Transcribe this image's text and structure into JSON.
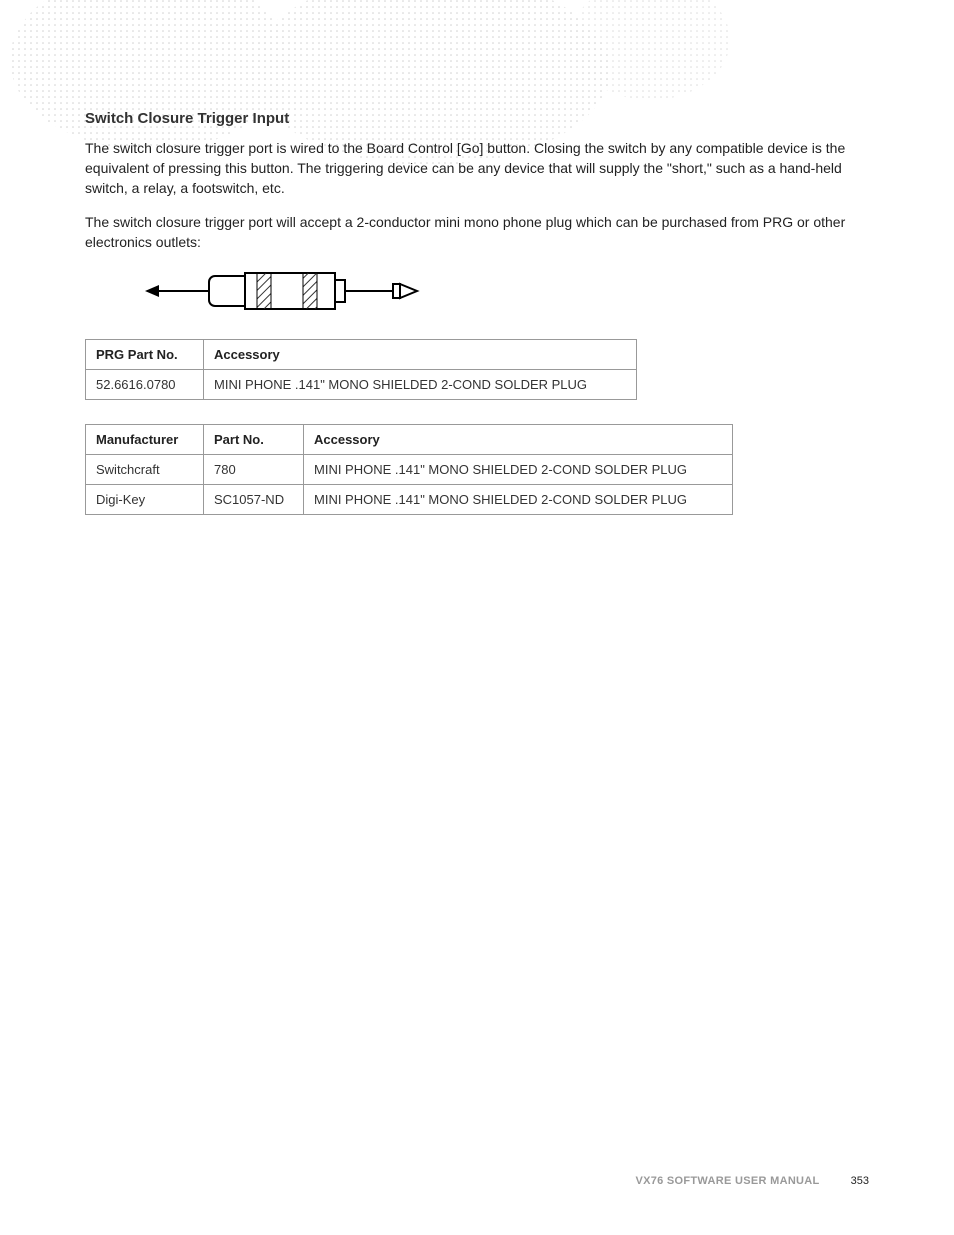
{
  "heading": "Switch Closure Trigger Input",
  "para1": "The switch closure trigger port is wired to the Board Control [Go] button. Closing the switch by any compatible device is the equivalent of pressing this button. The triggering device can be any device that will supply the \"short,\" such as a hand-held switch, a relay, a footswitch, etc.",
  "para2": "The switch closure trigger port will accept a 2-conductor mini mono phone plug which can be purchased from PRG or other electronics outlets:",
  "table1": {
    "headers": [
      "PRG Part No.",
      "Accessory"
    ],
    "rows": [
      [
        "52.6616.0780",
        "MINI PHONE .141\" MONO SHIELDED 2-COND SOLDER PLUG"
      ]
    ]
  },
  "table2": {
    "headers": [
      "Manufacturer",
      "Part No.",
      "Accessory"
    ],
    "rows": [
      [
        "Switchcraft",
        "780",
        "MINI PHONE .141\" MONO SHIELDED 2-COND SOLDER PLUG"
      ],
      [
        "Digi-Key",
        "SC1057-ND",
        "MINI PHONE .141\" MONO SHIELDED 2-COND SOLDER PLUG"
      ]
    ]
  },
  "footer": {
    "manual": "VX76 SOFTWARE USER MANUAL",
    "page": "353"
  }
}
